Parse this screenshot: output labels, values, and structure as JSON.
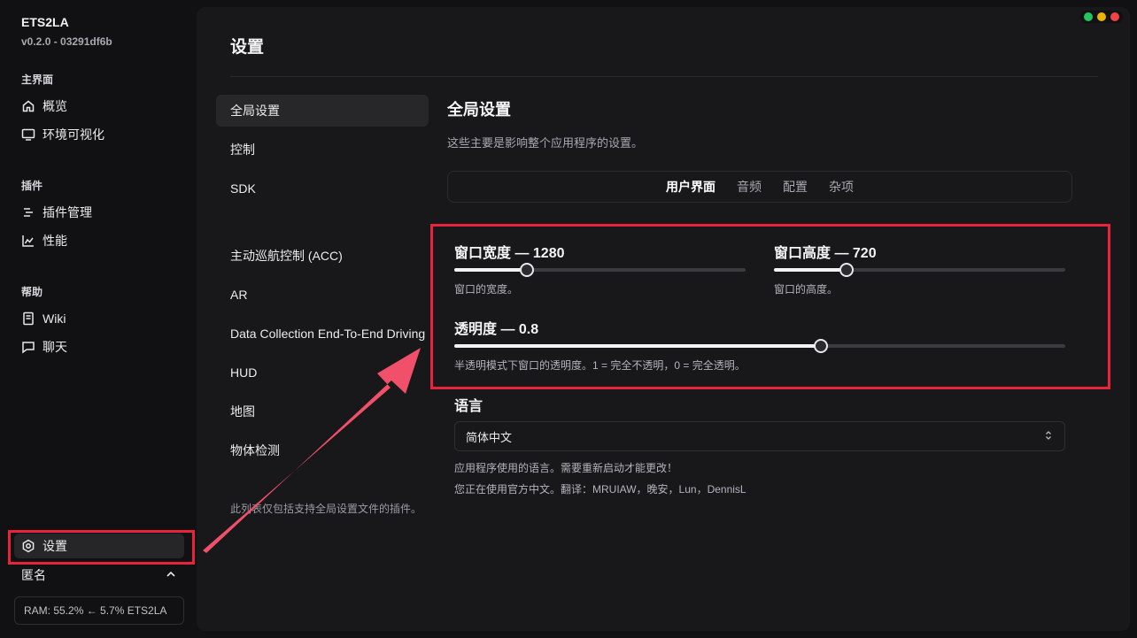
{
  "app": {
    "name": "ETS2LA",
    "version": "v0.2.0 - 03291df6b"
  },
  "sidebar": {
    "sections": [
      {
        "title": "主界面",
        "items": [
          {
            "label": "概览",
            "icon": "home-icon"
          },
          {
            "label": "环境可视化",
            "icon": "monitor-icon"
          }
        ]
      },
      {
        "title": "插件",
        "items": [
          {
            "label": "插件管理",
            "icon": "list-icon"
          },
          {
            "label": "性能",
            "icon": "chart-icon"
          }
        ]
      },
      {
        "title": "帮助",
        "items": [
          {
            "label": "Wiki",
            "icon": "book-icon"
          },
          {
            "label": "聊天",
            "icon": "chat-icon"
          }
        ]
      }
    ],
    "settings_label": "设置",
    "user_label": "匿名",
    "ram_text": "RAM: 55.2% ← 5.7% ETS2LA"
  },
  "page": {
    "title": "设置"
  },
  "subnav": {
    "items": [
      "全局设置",
      "控制",
      "SDK",
      "主动巡航控制 (ACC)",
      "AR",
      "Data Collection End-To-End Driving",
      "HUD",
      "地图",
      "物体检测"
    ],
    "note": "此列表仅包括支持全局设置文件的插件。"
  },
  "global": {
    "title": "全局设置",
    "description": "这些主要是影响整个应用程序的设置。",
    "tabs": [
      "用户界面",
      "音频",
      "配置",
      "杂项"
    ],
    "active_tab": "用户界面",
    "window_width": {
      "label": "窗口宽度 — 1280",
      "value": 1280,
      "min": 0,
      "max": 5120,
      "description": "窗口的宽度。"
    },
    "window_height": {
      "label": "窗口高度 — 720",
      "value": 720,
      "min": 0,
      "max": 2880,
      "description": "窗口的高度。"
    },
    "opacity": {
      "label": "透明度 — 0.8",
      "value": 0.8,
      "min": 0.5,
      "max": 1.0,
      "description": "半透明模式下窗口的透明度。1 = 完全不透明，0 = 完全透明。"
    },
    "language": {
      "label": "语言",
      "selected": "简体中文",
      "description": "应用程序使用的语言。需要重新启动才能更改！",
      "credits": "您正在使用官方中文。翻译：MRUIAW，晚安，Lun，DennisL"
    }
  },
  "colors": {
    "highlight": "#e8233b",
    "arrow": "#f0506a",
    "dot_green": "#22c55e",
    "dot_yellow": "#eab308",
    "dot_red": "#ef4444"
  }
}
